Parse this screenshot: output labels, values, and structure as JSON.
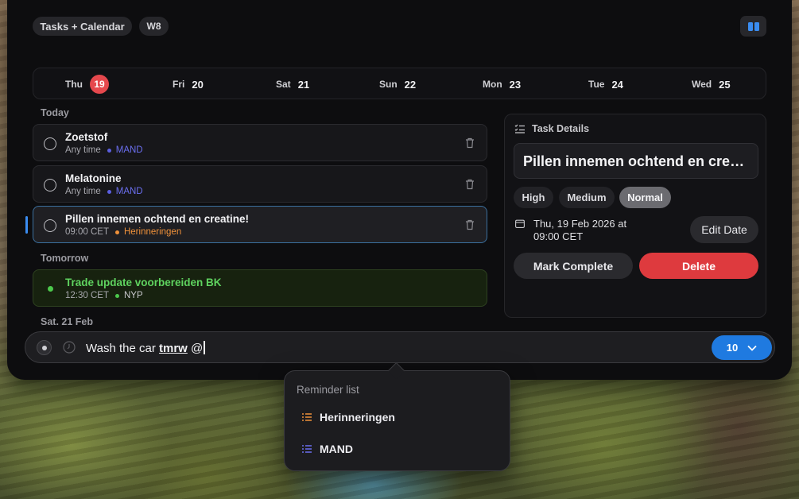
{
  "header": {
    "title": "Tasks + Calendar",
    "week_badge": "W8"
  },
  "week": [
    {
      "name": "Thu",
      "date": "19",
      "today": true
    },
    {
      "name": "Fri",
      "date": "20"
    },
    {
      "name": "Sat",
      "date": "21"
    },
    {
      "name": "Sun",
      "date": "22"
    },
    {
      "name": "Mon",
      "date": "23"
    },
    {
      "name": "Tue",
      "date": "24"
    },
    {
      "name": "Wed",
      "date": "25"
    }
  ],
  "sections": {
    "today": "Today",
    "tomorrow": "Tomorrow",
    "sat": "Sat, 21 Feb"
  },
  "tasks": [
    {
      "title": "Zoetstof",
      "time": "Any time",
      "list": "MAND",
      "list_color": "#5b5fe0"
    },
    {
      "title": "Melatonine",
      "time": "Any time",
      "list": "MAND",
      "list_color": "#5b5fe0"
    },
    {
      "title": "Pillen innemen ochtend en creatine!",
      "time": "09:00 CET",
      "list": "Herinneringen",
      "list_color": "#f0913a"
    },
    {
      "title": "Trade update voorbereiden BK",
      "time": "12:30 CET",
      "list": "NYP",
      "list_color": "#4cc94c"
    }
  ],
  "details": {
    "header": "Task Details",
    "title": "Pillen innemen ochtend en creatine!",
    "priorities": [
      "High",
      "Medium",
      "Normal"
    ],
    "selected_priority": "Normal",
    "date_line1": "Thu, 19 Feb 2026 at",
    "date_line2": "09:00 CET",
    "edit_date": "Edit Date",
    "mark_complete": "Mark Complete",
    "delete": "Delete"
  },
  "input": {
    "text_prefix": "Wash the car ",
    "keyword": "tmrw",
    "text_suffix": " @",
    "count": "10"
  },
  "popover": {
    "label": "Reminder list",
    "items": [
      {
        "name": "Herinneringen",
        "color": "#f0913a"
      },
      {
        "name": "MAND",
        "color": "#6b6ff0"
      }
    ]
  }
}
